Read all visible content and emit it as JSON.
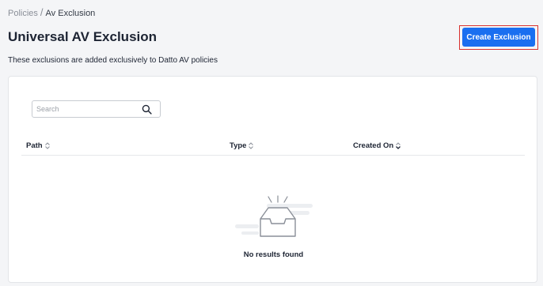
{
  "breadcrumb": {
    "parent": "Policies",
    "separator": "/",
    "current": "Av Exclusion"
  },
  "page": {
    "title": "Universal AV Exclusion",
    "subtitle": "These exclusions are added exclusively to Datto AV policies"
  },
  "actions": {
    "create_label": "Create Exclusion"
  },
  "search": {
    "placeholder": "Search",
    "value": ""
  },
  "table": {
    "columns": [
      {
        "label": "Path",
        "sort": "unsorted"
      },
      {
        "label": "Type",
        "sort": "unsorted"
      },
      {
        "label": "Created On",
        "sort": "descending"
      }
    ],
    "rows": [],
    "empty_text": "No results found"
  },
  "colors": {
    "primary": "#1a6ff0",
    "highlight_border": "#d9322f"
  }
}
